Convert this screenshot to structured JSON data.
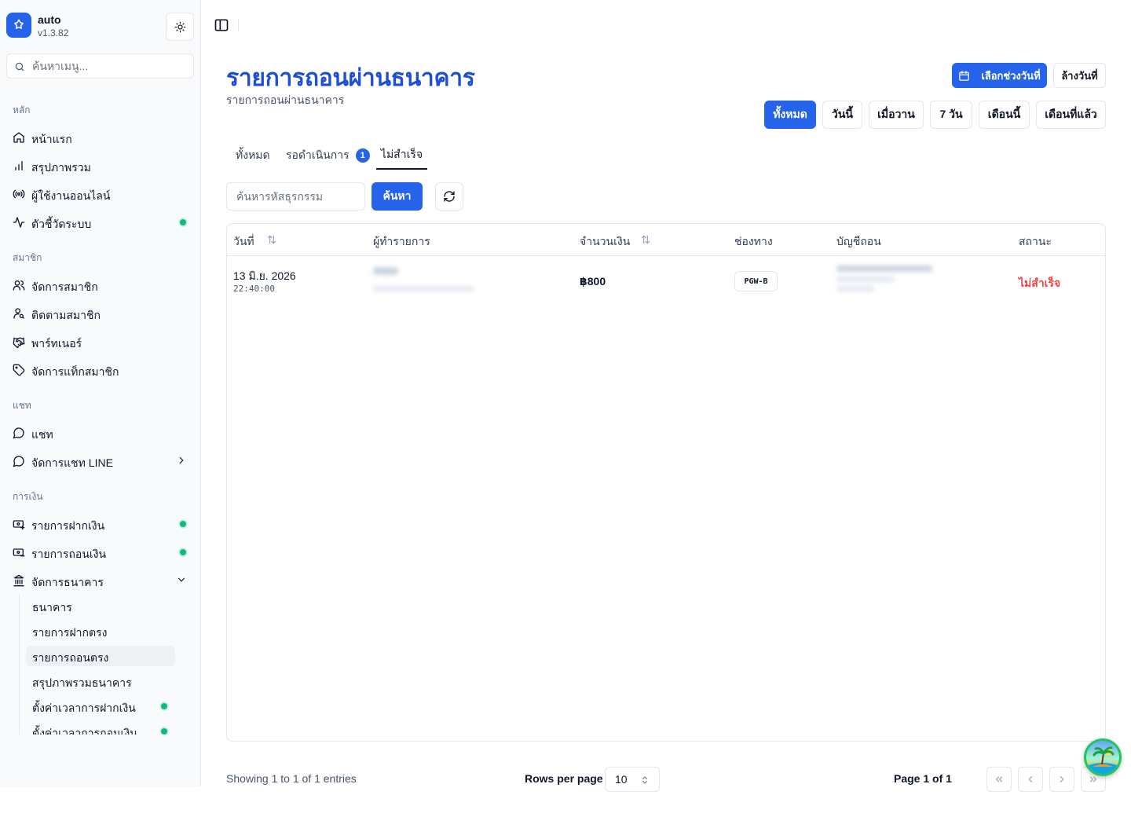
{
  "app": {
    "name": "auto",
    "version": "v1.3.82"
  },
  "sidebar": {
    "search_placeholder": "ค้นหาเมนู...",
    "sections": {
      "main": "หลัก",
      "members": "สมาชิก",
      "chat": "แชท",
      "finance": "การเงิน"
    },
    "items": {
      "home": "หน้าแรก",
      "overview": "สรุปภาพรวม",
      "online_users": "ผู้ใช้งานออนไลน์",
      "metrics": "ตัวชี้วัดระบบ",
      "manage_members": "จัดการสมาชิก",
      "track_members": "ติดตามสมาชิก",
      "partners": "พาร์ทเนอร์",
      "member_tags": "จัดการแท็กสมาชิก",
      "chat": "แชท",
      "line_chat": "จัดการแชท LINE",
      "deposits": "รายการฝากเงิน",
      "withdrawals": "รายการถอนเงิน",
      "bank_manage": "จัดการธนาคาร"
    },
    "bank_sub": [
      {
        "label": "ธนาคาร"
      },
      {
        "label": "รายการฝากตรง"
      },
      {
        "label": "รายการถอนตรง"
      },
      {
        "label": "สรุปภาพรวมธนาคาร"
      },
      {
        "label": "ตั้งค่าเวลาการฝากเงิน"
      },
      {
        "label": "ตั้งค่าเวลาการถอนเงิน"
      }
    ],
    "status_color": "#10b981"
  },
  "header": {
    "title": "รายการถอนผ่านธนาคาร",
    "subtitle": "รายการถอนผ่านธนาคาร",
    "date_picker_label": "เลือกช่วงวันที่",
    "clear_date_label": "ล้างวันที่",
    "ranges": [
      "ทั้งหมด",
      "วันนี้",
      "เมื่อวาน",
      "7 วัน",
      "เดือนนี้",
      "เดือนที่แล้ว"
    ],
    "active_range": "ทั้งหมด"
  },
  "tabs": {
    "all": "ทั้งหมด",
    "pending": "รอดำเนินการ",
    "pending_count": "1",
    "failed": "ไม่สำเร็จ"
  },
  "search": {
    "placeholder": "ค้นหารหัสธุรกรรม",
    "button": "ค้นหา"
  },
  "table": {
    "columns": [
      "วันที่",
      "ผู้ทำรายการ",
      "จำนวนเงิน",
      "ช่องทาง",
      "บัญชีถอน",
      "สถานะ"
    ],
    "rows": [
      {
        "date": "13 มิ.ย. 2026",
        "time": "22:40:00",
        "amount": "฿800",
        "channel": "PGW-B",
        "status": "ไม่สำเร็จ"
      }
    ]
  },
  "footer": {
    "showing": "Showing 1 to 1 of 1 entries",
    "rows_per_page_label": "Rows per page",
    "rows_per_page_value": "10",
    "page_info": "Page 1 of 1"
  },
  "colors": {
    "accent": "#2563eb",
    "title": "#1d4ed8",
    "danger": "#ef4444",
    "online": "#10b981"
  }
}
